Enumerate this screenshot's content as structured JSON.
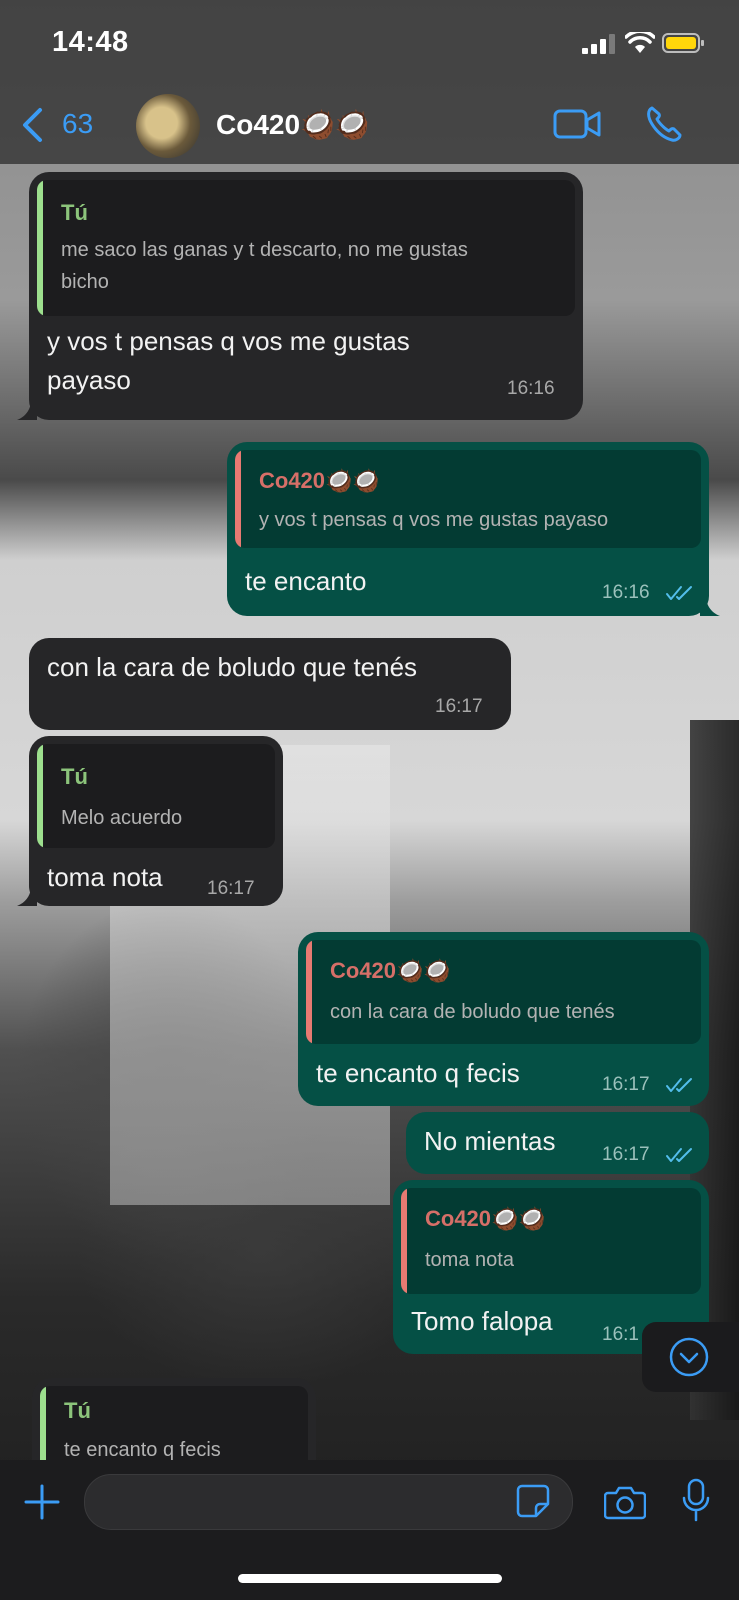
{
  "status_bar": {
    "time": "14:48"
  },
  "header": {
    "back_count": "63",
    "chat_name": "Co420🥥🥥"
  },
  "messages": [
    {
      "direction": "in",
      "quote_author": "Tú",
      "quote_text_line1": "me saco las ganas y t descarto, no me gustas",
      "quote_text_line2": "bicho",
      "text_line1": "y vos t pensas q vos me gustas",
      "text_line2": "payaso",
      "time": "16:16"
    },
    {
      "direction": "out",
      "quote_author": "Co420🥥🥥",
      "quote_text": "y vos t pensas q vos me gustas payaso",
      "text": "te encanto",
      "time": "16:16"
    },
    {
      "direction": "in",
      "text": "con la cara de boludo que tenés",
      "time": "16:17"
    },
    {
      "direction": "in",
      "quote_author": "Tú",
      "quote_text": "Melo acuerdo",
      "text": "toma nota",
      "time": "16:17"
    },
    {
      "direction": "out",
      "quote_author": "Co420🥥🥥",
      "quote_text": "con la cara de boludo que tenés",
      "text": "te encanto q fecis",
      "time": "16:17"
    },
    {
      "direction": "out",
      "text": "No mientas",
      "time": "16:17"
    },
    {
      "direction": "out",
      "quote_author": "Co420🥥🥥",
      "quote_text": "toma nota",
      "text": "Tomo falopa",
      "time": "16:1"
    },
    {
      "direction": "in",
      "quote_author": "Tú",
      "quote_text": "te encanto q fecis"
    }
  ],
  "colors": {
    "accent": "#3b9cf5",
    "outgoing": "#055045",
    "incoming": "#262628",
    "read_ticks": "#53bdeb"
  }
}
